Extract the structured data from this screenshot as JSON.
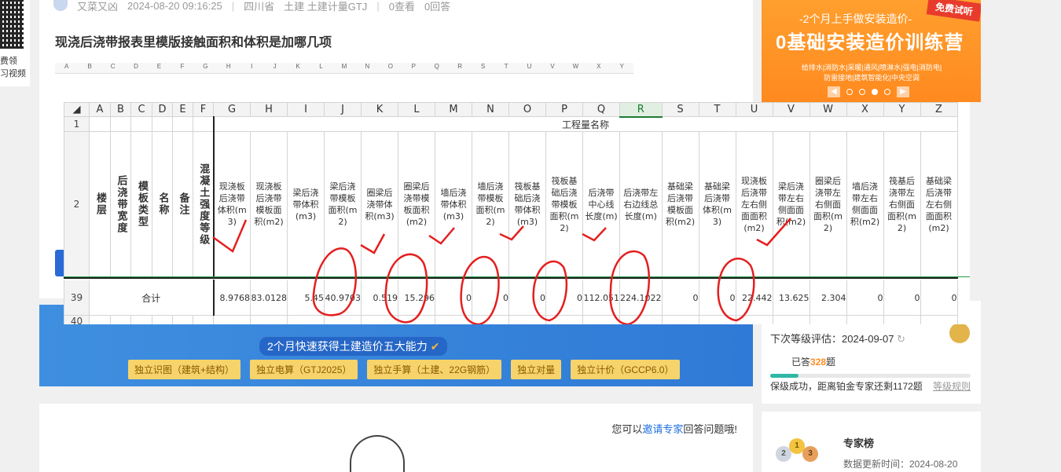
{
  "meta": {
    "author": "又菜又凶",
    "datetime": "2024-08-20 09:16:25",
    "region": "四川省",
    "tags": "土建 土建计量GTJ",
    "views": "0查看",
    "answers": "0回答"
  },
  "question_title": "现浇后浇带报表里模版接触面积和体积是加哪几项",
  "left_strip": {
    "line1": "费领",
    "line2": "习视频"
  },
  "banner": {
    "subtitle": "2个月快速获得土建造价五大能力",
    "buttons": [
      "独立识图（建筑+结构）",
      "独立电算（GTJ2025）",
      "独立手算（土建、22G钢筋）",
      "独立对量",
      "独立计价（GCCP6.0）"
    ]
  },
  "answer_prompt": {
    "prefix": "您可以",
    "link": "邀请专家",
    "suffix": "回答问题哦!"
  },
  "ad": {
    "tag": "免费试听",
    "line1": "-2个月上手做安装造价-",
    "title": "0基础安装造价训练营",
    "small": "给排水|消防水|采暖|通风|喷淋水|强电|消防电|防雷接地|建筑智能化|中央空调",
    "active_slide": 3
  },
  "level": {
    "next_eval": "下次等级评估：2024-09-07",
    "answered_prefix": "已答",
    "answered_count": "328",
    "answered_suffix": "题",
    "progress_percent": 14,
    "status": "保级成功，距离铂金专家还剩1172题",
    "rules_link": "等级规则"
  },
  "expert": {
    "title": "专家榜",
    "update": "数据更新时间：2024-08-20",
    "medals": [
      "2",
      "1",
      "3"
    ]
  },
  "sheet": {
    "column_letters": [
      "A",
      "B",
      "C",
      "D",
      "E",
      "F",
      "G",
      "H",
      "I",
      "J",
      "K",
      "L",
      "M",
      "N",
      "O",
      "P",
      "Q",
      "R",
      "S",
      "T",
      "U",
      "V",
      "W",
      "X",
      "Y",
      "Z"
    ],
    "selected_column": "R",
    "row_numbers": [
      "1",
      "2",
      "39",
      "40"
    ],
    "title": "工程量名称",
    "vertical_headers": [
      "楼层",
      "后浇带宽度",
      "模板类型",
      "名称",
      "备注",
      "混凝土强度等级"
    ],
    "headers": [
      "现浇板后浇带体积(m3)",
      "现浇板后浇带模板面积(m2)",
      "梁后浇带体积(m3)",
      "梁后浇带模板面积(m2)",
      "圈梁后浇带体积(m3)",
      "圈梁后浇带模板面积(m2)",
      "墙后浇带体积(m3)",
      "墙后浇带模板面积(m2)",
      "筏板基础后浇带体积(m3)",
      "筏板基础后浇带模板面积(m2)",
      "后浇带中心线长度(m)",
      "后浇带左右边线总长度(m)",
      "基础梁后浇带模板面积(m2)",
      "基础梁后浇带体积(m3)",
      "现浇板后浇带左右侧面面积(m2)",
      "梁后浇带左右侧面面积(m2)",
      "圈梁后浇带左右侧面面积(m2)",
      "墙后浇带左右侧面面积(m2)",
      "筏基后浇带左右侧面面积(m2)",
      "基础梁后浇带左右侧面面积(m2)"
    ],
    "total_label": "合计",
    "totals": [
      "8.9768",
      "83.0128",
      "5.45",
      "40.9703",
      "0.519",
      "15.296",
      "0",
      "0",
      "0",
      "0",
      "112.051",
      "224.1022",
      "0",
      "0",
      "22.442",
      "13.625",
      "2.304",
      "0",
      "0",
      "0"
    ]
  }
}
